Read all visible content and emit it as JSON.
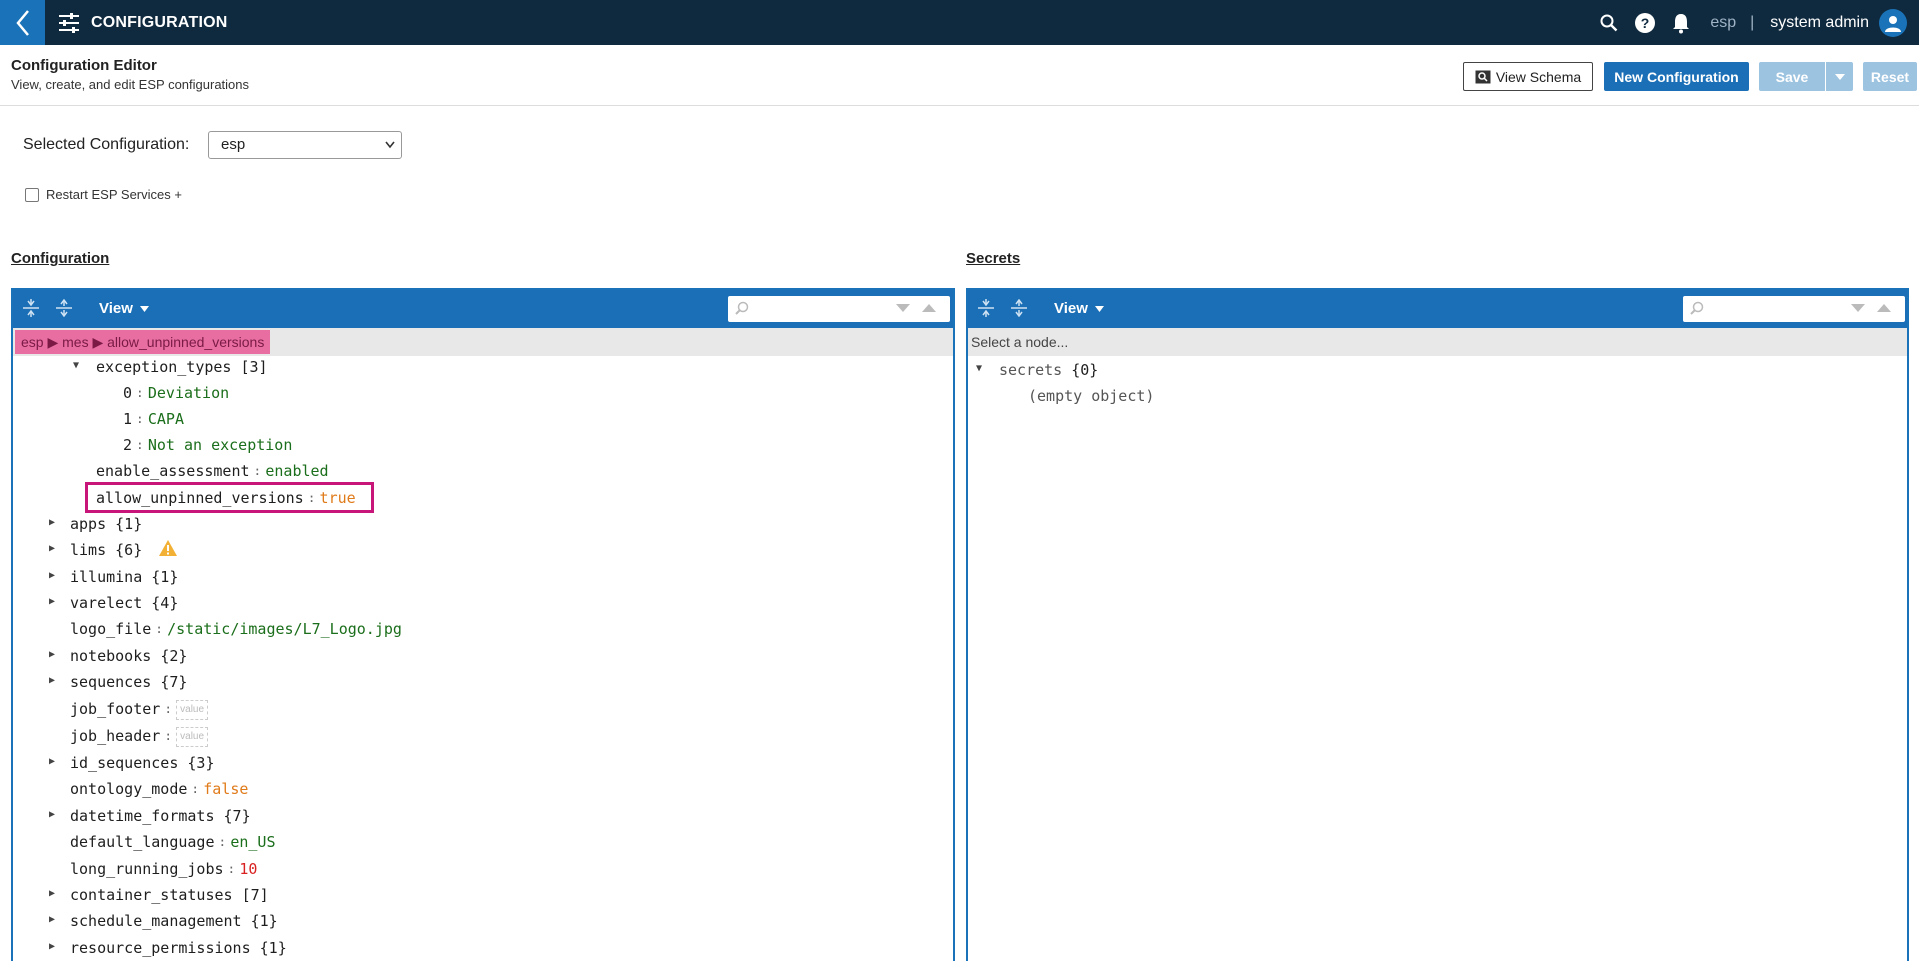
{
  "topbar": {
    "title": "CONFIGURATION",
    "tenant": "esp",
    "separator": "|",
    "username": "system admin"
  },
  "header": {
    "title": "Configuration Editor",
    "subtitle": "View, create, and edit ESP configurations",
    "view_schema_label": "View Schema",
    "new_config_label": "New Configuration",
    "save_label": "Save",
    "reset_label": "Reset"
  },
  "selection": {
    "label": "Selected Configuration:",
    "value": "esp",
    "restart_label": "Restart ESP Services +"
  },
  "config_panel": {
    "title": "Configuration",
    "view_label": "View",
    "breadcrumb": "esp ▶ mes ▶ allow_unpinned_versions",
    "rows": [
      {
        "key": "exception_types",
        "count": "[3]",
        "expanded": true
      },
      {
        "key": "0",
        "value": "Deviation",
        "type": "string"
      },
      {
        "key": "1",
        "value": "CAPA",
        "type": "string"
      },
      {
        "key": "2",
        "value": "Not an exception",
        "type": "string"
      },
      {
        "key": "enable_assessment",
        "value": "enabled",
        "type": "string"
      },
      {
        "key": "allow_unpinned_versions",
        "value": "true",
        "type": "boolean"
      },
      {
        "key": "apps",
        "count": "{1}"
      },
      {
        "key": "lims",
        "count": "{6}"
      },
      {
        "key": "illumina",
        "count": "{1}"
      },
      {
        "key": "varelect",
        "count": "{4}"
      },
      {
        "key": "logo_file",
        "value": "/static/images/L7_Logo.jpg",
        "type": "string"
      },
      {
        "key": "notebooks",
        "count": "{2}"
      },
      {
        "key": "sequences",
        "count": "{7}"
      },
      {
        "key": "job_footer",
        "placeholder": "value"
      },
      {
        "key": "job_header",
        "placeholder": "value"
      },
      {
        "key": "id_sequences",
        "count": "{3}"
      },
      {
        "key": "ontology_mode",
        "value": "false",
        "type": "boolean"
      },
      {
        "key": "datetime_formats",
        "count": "{7}"
      },
      {
        "key": "default_language",
        "value": "en_US",
        "type": "string"
      },
      {
        "key": "long_running_jobs",
        "value": "10",
        "type": "number"
      },
      {
        "key": "container_statuses",
        "count": "[7]"
      },
      {
        "key": "schedule_management",
        "count": "{1}"
      },
      {
        "key": "resource_permissions",
        "count": "{1}"
      }
    ]
  },
  "secrets_panel": {
    "title": "Secrets",
    "view_label": "View",
    "hint": "Select a node...",
    "root_key": "secrets",
    "root_count": "{0}",
    "empty_text": "(empty object)"
  },
  "colors": {
    "navbar": "#0f2a3f",
    "primary": "#1a6fb6",
    "highlight": "#c8157a",
    "string": "#1b6e1b",
    "boolean": "#e07b1a",
    "number": "#d92020"
  }
}
